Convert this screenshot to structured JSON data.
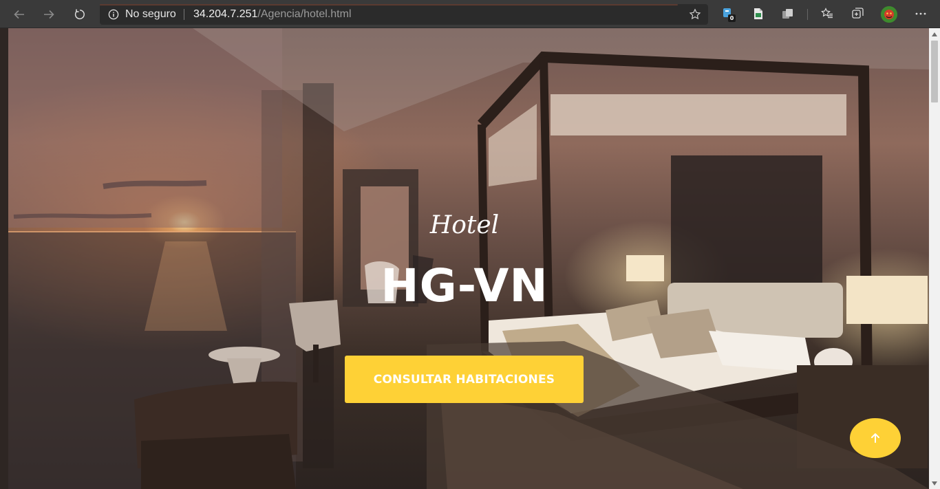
{
  "browser": {
    "security_label": "No seguro",
    "url_host": "34.204.7.251",
    "url_path": "/Agencia/hotel.html",
    "extension_badge": "0",
    "icons": [
      "back-arrow-icon",
      "forward-arrow-icon",
      "reload-icon",
      "info-icon",
      "star-icon",
      "extension-icon",
      "sheet-icon",
      "collections-icon",
      "favorites-icon",
      "tab-actions-icon",
      "profile-avatar",
      "more-icon"
    ]
  },
  "hero": {
    "subtitle": "Hotel",
    "title": "HG-VN",
    "cta_label": "CONSULTAR HABITACIONES"
  },
  "colors": {
    "accent": "#fed136",
    "chrome": "#3a3a3a",
    "omnibox": "#2b2b2b"
  }
}
